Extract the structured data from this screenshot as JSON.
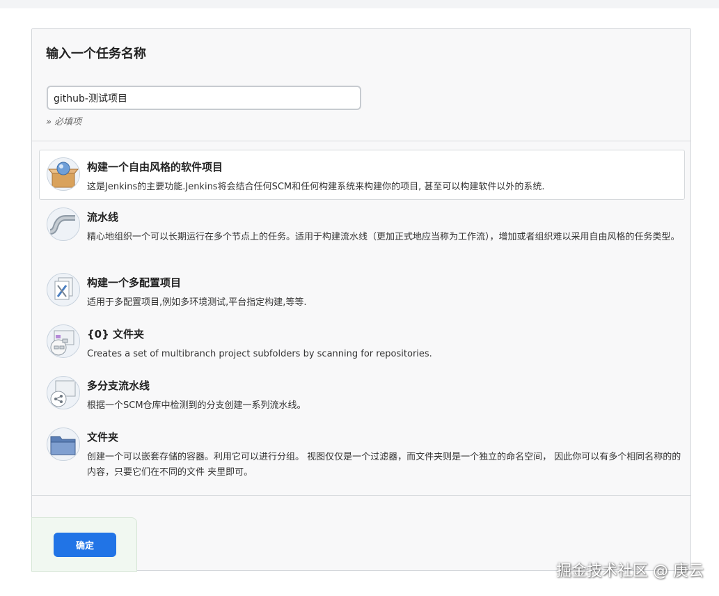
{
  "form": {
    "title": "输入一个任务名称",
    "name_value": "github-测试项目",
    "required_hint": "» 必填项"
  },
  "item_types": [
    {
      "title": "构建一个自由风格的软件项目",
      "description": "这是Jenkins的主要功能.Jenkins将会结合任何SCM和任何构建系统来构建你的项目, 甚至可以构建软件以外的系统.",
      "icon": "freestyle-project-icon",
      "selected": true
    },
    {
      "title": "流水线",
      "description": "精心地组织一个可以长期运行在多个节点上的任务。适用于构建流水线（更加正式地应当称为工作流），增加或者组织难以采用自由风格的任务类型。",
      "icon": "pipeline-icon",
      "selected": false
    },
    {
      "title": "构建一个多配置项目",
      "description": "适用于多配置项目,例如多环境测试,平台指定构建,等等.",
      "icon": "multi-config-icon",
      "selected": false
    },
    {
      "title": "{0} 文件夹",
      "description": "Creates a set of multibranch project subfolders by scanning for repositories.",
      "icon": "org-folder-icon",
      "selected": false
    },
    {
      "title": "多分支流水线",
      "description": "根据一个SCM仓库中检测到的分支创建一系列流水线。",
      "icon": "multibranch-pipeline-icon",
      "selected": false
    },
    {
      "title": "文件夹",
      "description": "创建一个可以嵌套存储的容器。利用它可以进行分组。 视图仅仅是一个过滤器，而文件夹则是一个独立的命名空间， 因此你可以有多个相同名称的的内容，只要它们在不同的文件 夹里即可。",
      "icon": "folder-icon",
      "selected": false
    }
  ],
  "footer": {
    "ok_label": "确定"
  },
  "watermark": "掘金技术社区 @ 庚云",
  "colors": {
    "accent": "#2174e6",
    "panel_bg": "#f8f8f9"
  }
}
